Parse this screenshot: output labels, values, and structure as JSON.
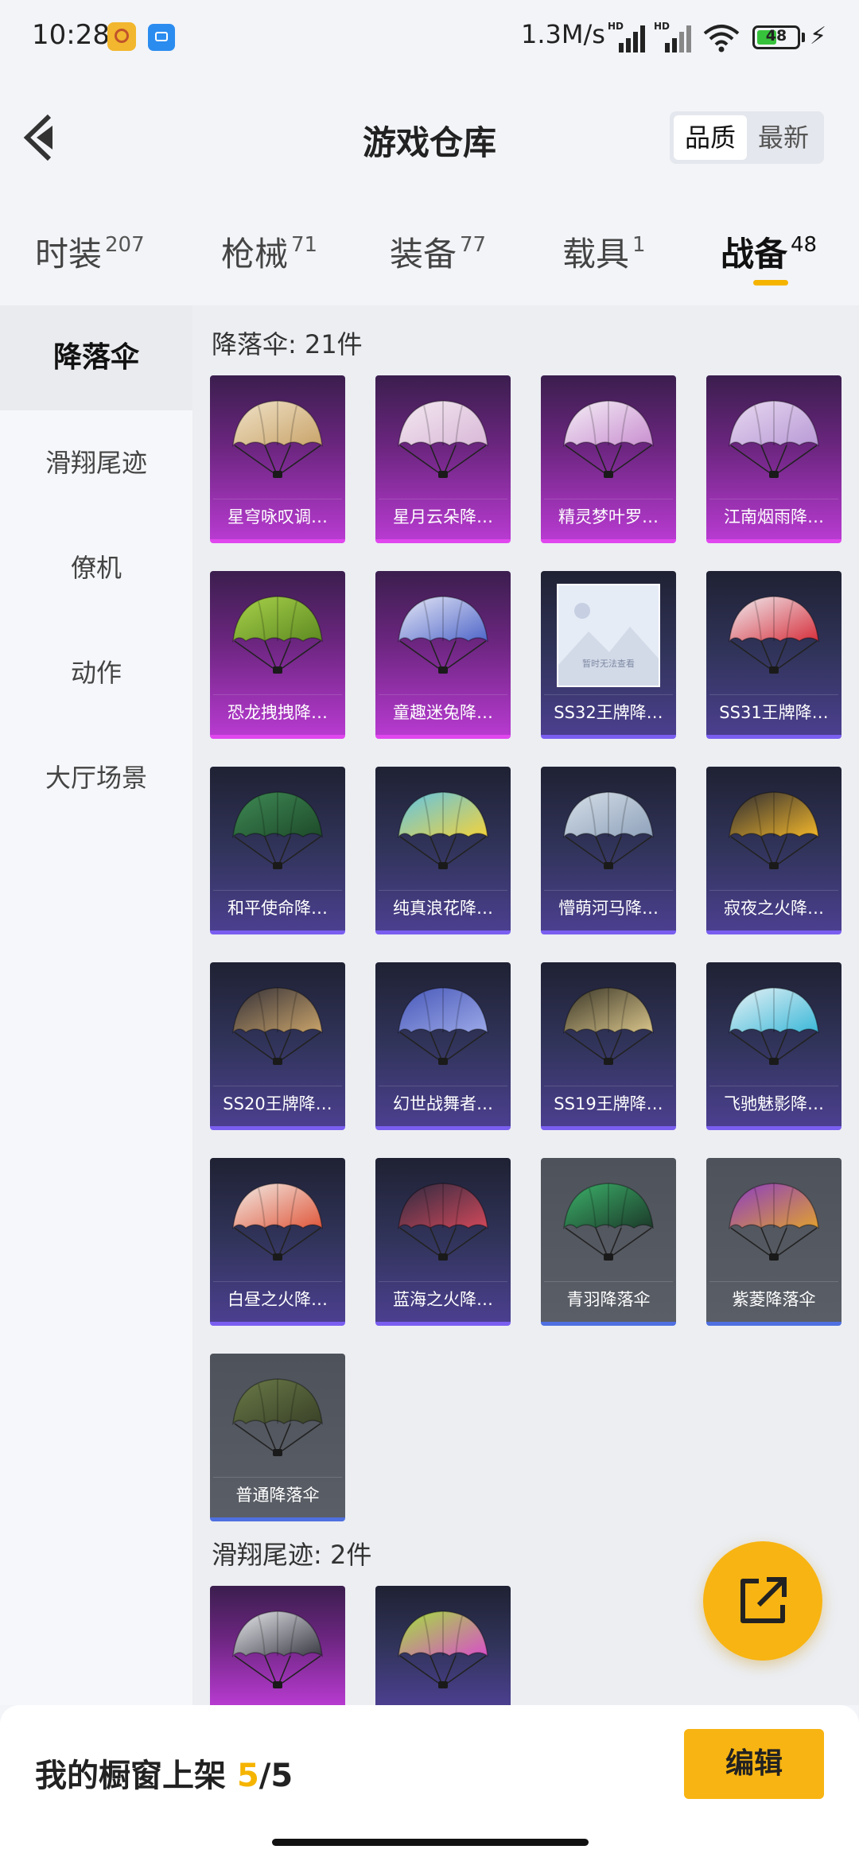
{
  "status_bar": {
    "time": "10:28",
    "net_speed": "1.3M/s",
    "hd_label": "HD",
    "battery_level": "48",
    "charging_symbol": "⚡",
    "icons": [
      "app-icon-game-helper",
      "app-icon-blue-app",
      "signal-icon",
      "signal-icon",
      "wifi-icon",
      "battery-icon",
      "charging-icon"
    ]
  },
  "header": {
    "title": "游戏仓库",
    "sort_options": [
      {
        "label": "品质",
        "active": true
      },
      {
        "label": "最新",
        "active": false
      }
    ]
  },
  "tabs": [
    {
      "label": "时装",
      "count": "207",
      "active": false
    },
    {
      "label": "枪械",
      "count": "71",
      "active": false
    },
    {
      "label": "装备",
      "count": "77",
      "active": false
    },
    {
      "label": "载具",
      "count": "1",
      "active": false
    },
    {
      "label": "战备",
      "count": "48",
      "active": true
    }
  ],
  "sidebar": {
    "items": [
      {
        "label": "降落伞",
        "active": true
      },
      {
        "label": "滑翔尾迹",
        "active": false
      },
      {
        "label": "僚机",
        "active": false
      },
      {
        "label": "动作",
        "active": false
      },
      {
        "label": "大厅场景",
        "active": false
      }
    ]
  },
  "sections": [
    {
      "title": "降落伞: 21件",
      "items": [
        {
          "name": "星穹咏叹调…",
          "rarity": "magenta",
          "colors": [
            "#f0e2c8",
            "#c9a46a"
          ]
        },
        {
          "name": "星月云朵降…",
          "rarity": "magenta",
          "colors": [
            "#f3e8f0",
            "#d9b8d8"
          ]
        },
        {
          "name": "精灵梦叶罗…",
          "rarity": "magenta",
          "colors": [
            "#f4eef6",
            "#c98fd0"
          ]
        },
        {
          "name": "江南烟雨降…",
          "rarity": "magenta",
          "colors": [
            "#e8d8f0",
            "#b89ad6"
          ]
        },
        {
          "name": "恐龙拽拽降…",
          "rarity": "magenta",
          "colors": [
            "#a8d24a",
            "#5e8a22"
          ]
        },
        {
          "name": "童趣迷兔降…",
          "rarity": "magenta",
          "colors": [
            "#e6e8f6",
            "#4f66c9"
          ]
        },
        {
          "name": "SS32王牌降…",
          "rarity": "blue",
          "colors": [
            "#e6ecf6",
            "#c8d4e8"
          ],
          "placeholder_text": "暂时无法查看"
        },
        {
          "name": "SS31王牌降…",
          "rarity": "blue",
          "colors": [
            "#f0eef2",
            "#d6303c"
          ]
        },
        {
          "name": "和平使命降…",
          "rarity": "blue",
          "colors": [
            "#3f8a55",
            "#1e4a2a"
          ]
        },
        {
          "name": "纯真浪花降…",
          "rarity": "blue",
          "colors": [
            "#5ec4e8",
            "#f2d23c"
          ]
        },
        {
          "name": "懵萌河马降…",
          "rarity": "blue",
          "colors": [
            "#d6dfe8",
            "#8fa2bb"
          ]
        },
        {
          "name": "寂夜之火降…",
          "rarity": "blue",
          "colors": [
            "#2a2a33",
            "#f2b62a"
          ]
        },
        {
          "name": "SS20王牌降…",
          "rarity": "blue",
          "colors": [
            "#333038",
            "#c9a36a"
          ]
        },
        {
          "name": "幻世战舞者…",
          "rarity": "blue",
          "colors": [
            "#4858b8",
            "#9ba8e8"
          ]
        },
        {
          "name": "SS19王牌降…",
          "rarity": "blue",
          "colors": [
            "#3a3628",
            "#d8c48a"
          ]
        },
        {
          "name": "飞驰魅影降…",
          "rarity": "blue",
          "colors": [
            "#e8f2f6",
            "#3bb8d8"
          ]
        },
        {
          "name": "白昼之火降…",
          "rarity": "blue",
          "colors": [
            "#f2ece6",
            "#e0583c"
          ]
        },
        {
          "name": "蓝海之火降…",
          "rarity": "blue",
          "colors": [
            "#2c2a40",
            "#d0485a"
          ]
        },
        {
          "name": "青羽降落伞",
          "rarity": "gray",
          "colors": [
            "#3cb26a",
            "#1c3a2a"
          ]
        },
        {
          "name": "紫菱降落伞",
          "rarity": "gray",
          "colors": [
            "#8a3cc4",
            "#e0a030"
          ]
        },
        {
          "name": "普通降落伞",
          "rarity": "gray",
          "colors": [
            "#6a7a48",
            "#3a4228"
          ]
        }
      ]
    },
    {
      "title": "滑翔尾迹: 2件",
      "items": [
        {
          "name": "",
          "rarity": "magenta",
          "colors": [
            "#e8e8ee",
            "#3a3a44"
          ]
        },
        {
          "name": "",
          "rarity": "blue",
          "colors": [
            "#a2e23c",
            "#d850c8"
          ]
        }
      ]
    }
  ],
  "fab_icon": "share-icon",
  "showcase": {
    "label": "我的橱窗上架 ",
    "current": "5",
    "separator": "/",
    "max": "5",
    "edit_label": "编辑"
  },
  "accent_color": "#f8b412"
}
